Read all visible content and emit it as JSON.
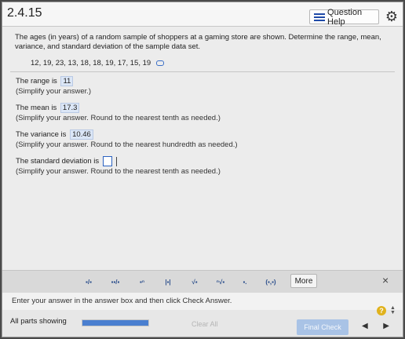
{
  "header": {
    "problem_number": "2.4.15",
    "help_label": "Question Help"
  },
  "question": {
    "prompt": "The ages (in years) of a random sample of shoppers at a gaming store are shown. Determine the range, mean, variance, and standard deviation of the sample data set.",
    "data_values": "12, 19, 23, 13, 18, 18, 19, 17, 15, 19"
  },
  "parts": [
    {
      "label": "The range is",
      "answer": "11",
      "hint": "(Simplify your answer.)"
    },
    {
      "label": "The mean is",
      "answer": "17.3",
      "hint": "(Simplify your answer. Round to the nearest tenth as needed.)"
    },
    {
      "label": "The variance is",
      "answer": "10.46",
      "hint": "(Simplify your answer. Round to the nearest hundredth as needed.)"
    },
    {
      "label": "The standard deviation is",
      "answer": "",
      "hint": "(Simplify your answer. Round to the nearest tenth as needed.)"
    }
  ],
  "toolbar": {
    "more_label": "More",
    "close_symbol": "×",
    "tools": [
      {
        "name": "fraction",
        "symbol": "▪/▪"
      },
      {
        "name": "mixed-number",
        "symbol": "▪▪/▪"
      },
      {
        "name": "exponent",
        "symbol": "▪ⁿ"
      },
      {
        "name": "absolute-value",
        "symbol": "|▪|"
      },
      {
        "name": "square-root",
        "symbol": "√▪"
      },
      {
        "name": "nth-root",
        "symbol": "ⁿ√▪"
      },
      {
        "name": "subscript",
        "symbol": "▪."
      },
      {
        "name": "ordered-pair",
        "symbol": "(▪,▪)"
      }
    ]
  },
  "instruction": "Enter your answer in the answer box and then click Check Answer.",
  "footer": {
    "parts_label": "All parts showing",
    "clear_all_label": "Clear All",
    "final_check_label": "Final Check",
    "help_symbol": "?",
    "prev_symbol": "◀",
    "next_symbol": "▶"
  },
  "colors": {
    "accent": "#2b62c0",
    "answer_box_bg": "#dbe6f6",
    "final_check_bg": "#a9c3e6",
    "help_circle": "#e0b21c"
  }
}
